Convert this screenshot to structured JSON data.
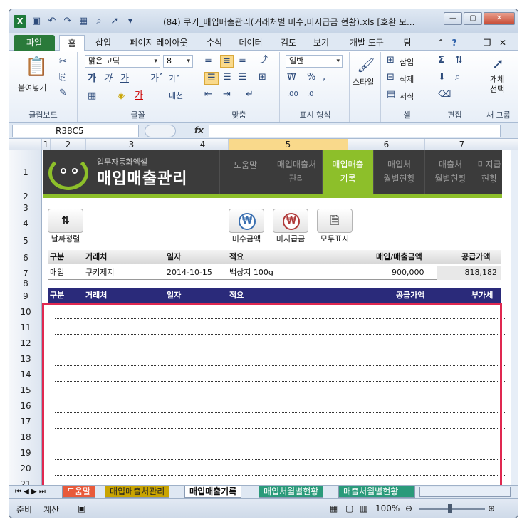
{
  "window": {
    "title": "(84) 쿠키_매입매출관리(거래처별 미수,미지급금 현황).xls  [호환 모..."
  },
  "ribbon_tabs": [
    "파일",
    "홈",
    "삽입",
    "페이지 레이아웃",
    "수식",
    "데이터",
    "검토",
    "보기",
    "개발 도구",
    "팀"
  ],
  "ribbon": {
    "paste_label": "붙여넣기",
    "clipboard_group": "클립보드",
    "font_name": "맑은 고딕",
    "font_size": "8",
    "font_group": "글꼴",
    "align_group": "맞춤",
    "number_format": "일반",
    "number_group": "표시 형식",
    "style_label": "스타일",
    "insert_label": "삽입",
    "delete_label": "삭제",
    "format_label": "서식",
    "cell_group": "셀",
    "edit_group": "편집",
    "object_select_line1": "개체",
    "object_select_line2": "선택",
    "new_group": "새 그룹"
  },
  "namebox": "R38C5",
  "columns": [
    "1",
    "2",
    "3",
    "4",
    "5",
    "6",
    "7"
  ],
  "rows": [
    "1",
    "2",
    "3",
    "4",
    "5",
    "6",
    "7",
    "8",
    "9",
    "10",
    "11",
    "12",
    "13",
    "14",
    "15",
    "16",
    "17",
    "18",
    "19",
    "20",
    "21"
  ],
  "banner": {
    "subtitle": "업무자동화엑셀",
    "title": "매입매출관리",
    "nav": [
      {
        "line1": "도움말",
        "line2": ""
      },
      {
        "line1": "매입매출처",
        "line2": "관리"
      },
      {
        "line1": "매입매출",
        "line2": "기록"
      },
      {
        "line1": "매입처",
        "line2": "월별현황"
      },
      {
        "line1": "매출처",
        "line2": "월별현황"
      },
      {
        "line1": "미지급",
        "line2": "현황"
      }
    ]
  },
  "tools": {
    "sort_label": "날짜정렬",
    "receivable_label": "미수금액",
    "payable_label": "미지급금",
    "showall_label": "모두표시"
  },
  "header1": [
    "구분",
    "거래처",
    "일자",
    "적요",
    "매입/매출금액",
    "공급가액"
  ],
  "entry": {
    "type": "매입",
    "client": "쿠키제지",
    "date": "2014-10-15",
    "memo": "백상지 100g",
    "amount": "900,000",
    "supply": "818,182"
  },
  "header2": [
    "구분",
    "거래처",
    "일자",
    "적요",
    "공급가액",
    "부가세"
  ],
  "sheet_tabs": [
    "도움말",
    "매입매출처관리",
    "매입매출기록",
    "매입처월별현황",
    "매출처월별현황"
  ],
  "status": {
    "ready": "준비",
    "calc": "계산",
    "zoom": "100%"
  }
}
